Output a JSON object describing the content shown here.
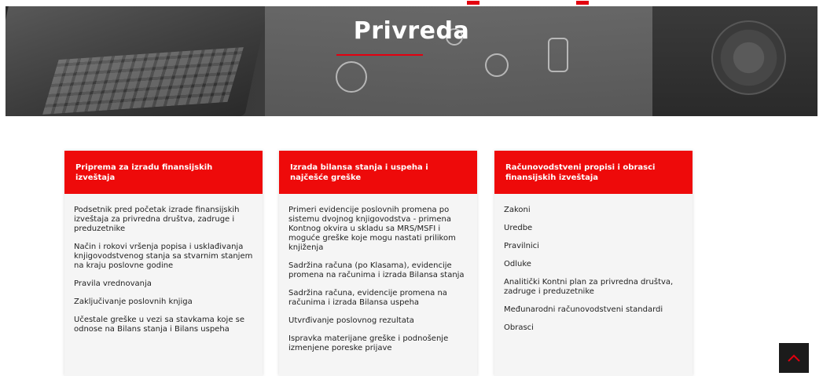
{
  "hero": {
    "title": "Privreda"
  },
  "cards": [
    {
      "title": "Priprema za izradu finansijskih izveštaja",
      "items": [
        "Podsetnik pred početak izrade finansijskih izveštaja za privredna društva, zadruge i preduzetnike",
        "Način i rokovi vršenja popisa i usklađivanja knjigovodstvenog stanja sa stvarnim stanjem na kraju poslovne godine",
        "Pravila vrednovanja",
        "Zaključivanje poslovnih knjiga",
        "Učestale greške u vezi sa stavkama koje se odnose na Bilans stanja i Bilans uspeha"
      ]
    },
    {
      "title": "Izrada bilansa stanja i uspeha i najčešće greške",
      "items": [
        "Primeri evidencije poslovnih promena po sistemu dvojnog knjigovodstva - primena Kontnog okvira u skladu sa MRS/MSFI i moguće greške koje mogu nastati prilikom knjiženja",
        "Sadržina računa (po Klasama), evidencije promena na računima i izrada Bilansa stanja",
        "Sadržina računa, evidencije promena na računima i izrada Bilansa uspeha",
        "Utvrđivanje poslovnog rezultata",
        "Ispravka materijane greške i podnošenje izmenjene poreske prijave"
      ]
    },
    {
      "title": "Računovodstveni propisi i obrasci finansijskih izveštaja",
      "items": [
        "Zakoni",
        "Uredbe",
        "Pravilnici",
        "Odluke",
        "Analitički Kontni plan za privredna društva, zadruge i preduzetnike",
        "Međunarodni računovodstveni standardi",
        "Obrasci"
      ]
    }
  ],
  "icons": {
    "scroll_top": "chevron-up-icon"
  },
  "colors": {
    "accent": "#ee0a0a",
    "card_bg": "#f5f5f5",
    "scroll_btn": "#1b1b1b"
  }
}
